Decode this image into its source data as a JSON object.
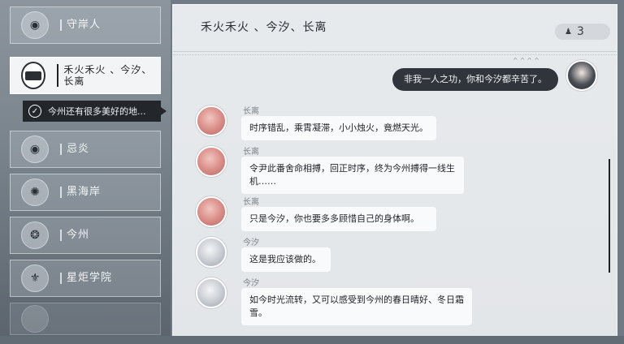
{
  "sidebar": {
    "contacts": [
      {
        "label": "守岸人",
        "icon": "portrait-icon"
      },
      {
        "label": "禾火禾火 、今汐、长离",
        "icon": "group-chat-icon"
      },
      {
        "label": "忌炎",
        "icon": "portrait-icon"
      },
      {
        "label": "黑海岸",
        "icon": "emblem-icon"
      },
      {
        "label": "今州",
        "icon": "emblem-icon"
      },
      {
        "label": "星炬学院",
        "icon": "emblem-icon"
      }
    ],
    "subtopic": {
      "label": "今州还有很多美好的地..."
    }
  },
  "chat": {
    "title": "禾火禾火 、今汐、长离",
    "counter": "3",
    "messages": [
      {
        "speaker": "",
        "text": "非我一人之功，你和今汐都辛苦了。",
        "direction": "outgoing"
      },
      {
        "speaker": "长离",
        "text": "时序错乱，乘霄凝滞，小小烛火，竟燃天光。",
        "direction": "incoming"
      },
      {
        "speaker": "长离",
        "text": "令尹此番舍命相搏，回正时序，终为今州搏得一线生机……",
        "direction": "incoming"
      },
      {
        "speaker": "长离",
        "text": "只是今汐，你也要多多顾惜自己的身体啊。",
        "direction": "incoming"
      },
      {
        "speaker": "今汐",
        "text": "这是我应该做的。",
        "direction": "incoming"
      },
      {
        "speaker": "今汐",
        "text": "如今时光流转，又可以感受到今州的春日晴好、冬日霜雪。",
        "direction": "incoming"
      }
    ]
  },
  "colors": {
    "outgoing_bubble": "#30353b",
    "incoming_bubble": "#f9fafb",
    "active_contact": "#f3f4f5"
  }
}
